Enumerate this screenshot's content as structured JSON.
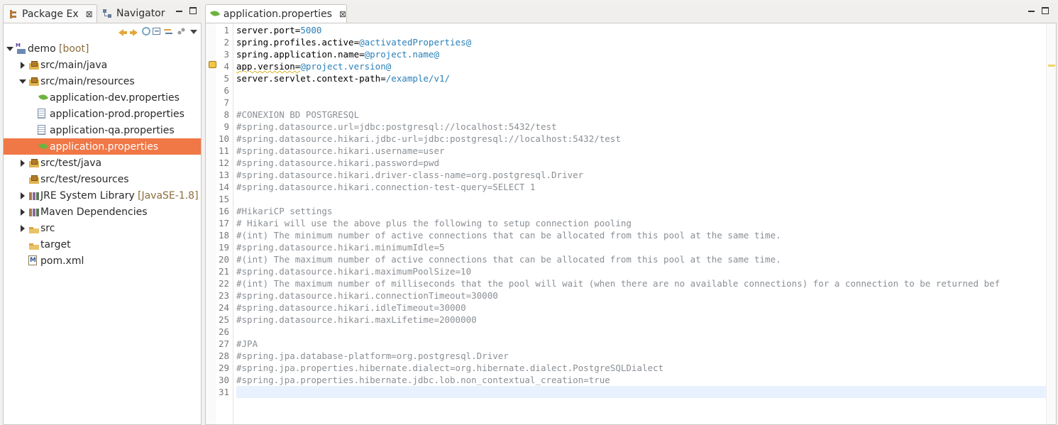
{
  "left_view": {
    "tabs": [
      {
        "label": "Package Ex",
        "close": "⊠"
      },
      {
        "label": "Navigator"
      }
    ],
    "tree": [
      {
        "label": "demo",
        "decoration": "[boot]",
        "icon": "project-icon",
        "indent": 0,
        "twisty": "open"
      },
      {
        "label": "src/main/java",
        "icon": "package-folder-icon",
        "indent": 1,
        "twisty": "closed"
      },
      {
        "label": "src/main/resources",
        "icon": "package-folder-icon",
        "indent": 1,
        "twisty": "open"
      },
      {
        "label": "application-dev.properties",
        "icon": "spring-leaf-icon",
        "indent": 2,
        "twisty": "none"
      },
      {
        "label": "application-prod.properties",
        "icon": "text-file-icon",
        "indent": 2,
        "twisty": "none"
      },
      {
        "label": "application-qa.properties",
        "icon": "text-file-icon",
        "indent": 2,
        "twisty": "none"
      },
      {
        "label": "application.properties",
        "icon": "spring-leaf-icon",
        "indent": 2,
        "twisty": "none",
        "selected": true
      },
      {
        "label": "src/test/java",
        "icon": "package-folder-icon",
        "indent": 1,
        "twisty": "closed"
      },
      {
        "label": "src/test/resources",
        "icon": "package-folder-icon",
        "indent": 1,
        "twisty": "none"
      },
      {
        "label": "JRE System Library",
        "decoration": "[JavaSE-1.8]",
        "icon": "library-icon",
        "indent": 1,
        "twisty": "closed"
      },
      {
        "label": "Maven Dependencies",
        "icon": "library-icon",
        "indent": 1,
        "twisty": "closed"
      },
      {
        "label": "src",
        "icon": "folder-icon",
        "indent": 1,
        "twisty": "closed"
      },
      {
        "label": "target",
        "icon": "folder-icon",
        "indent": 1,
        "twisty": "none"
      },
      {
        "label": "pom.xml",
        "icon": "maven-xml-icon",
        "indent": 1,
        "twisty": "none"
      }
    ],
    "selection_color": "#f07746"
  },
  "editor": {
    "tab": {
      "label": "application.properties",
      "close": "⊠"
    },
    "lines": [
      [
        {
          "t": "server.port=",
          "s": "k"
        },
        {
          "t": "5000",
          "s": "v"
        }
      ],
      [
        {
          "t": "spring.profiles.active=",
          "s": "k"
        },
        {
          "t": "@activatedProperties@",
          "s": "v"
        }
      ],
      [
        {
          "t": "spring.application.name=",
          "s": "k"
        },
        {
          "t": "@project.name@",
          "s": "v"
        }
      ],
      [
        {
          "t": "app.version=",
          "s": "k",
          "warn": true
        },
        {
          "t": "@project.version@",
          "s": "v"
        }
      ],
      [
        {
          "t": "server.servlet.context-path=",
          "s": "k"
        },
        {
          "t": "/example/v1/",
          "s": "v"
        }
      ],
      [],
      [],
      [
        {
          "t": "#CONEXION BD POSTGRESQL",
          "s": "c"
        }
      ],
      [
        {
          "t": "#spring.datasource.url=jdbc:postgresql://localhost:5432/test",
          "s": "c"
        }
      ],
      [
        {
          "t": "#spring.datasource.hikari.jdbc-url=jdbc:postgresql://localhost:5432/test",
          "s": "c"
        }
      ],
      [
        {
          "t": "#spring.datasource.hikari.username=user",
          "s": "c"
        }
      ],
      [
        {
          "t": "#spring.datasource.hikari.password=pwd",
          "s": "c"
        }
      ],
      [
        {
          "t": "#spring.datasource.hikari.driver-class-name=org.postgresql.Driver",
          "s": "c"
        }
      ],
      [
        {
          "t": "#spring.datasource.hikari.connection-test-query=SELECT 1",
          "s": "c"
        }
      ],
      [],
      [
        {
          "t": "#HikariCP settings",
          "s": "c"
        }
      ],
      [
        {
          "t": "# Hikari will use the above plus the following to setup connection pooling",
          "s": "c"
        }
      ],
      [
        {
          "t": "#(int) The minimum number of active connections that can be allocated from this pool at the same time.",
          "s": "c"
        }
      ],
      [
        {
          "t": "#spring.datasource.hikari.minimumIdle=5",
          "s": "c"
        }
      ],
      [
        {
          "t": "#(int) The maximum number of active connections that can be allocated from this pool at the same time.",
          "s": "c"
        }
      ],
      [
        {
          "t": "#spring.datasource.hikari.maximumPoolSize=10",
          "s": "c"
        }
      ],
      [
        {
          "t": "#(int) The maximum number of milliseconds that the pool will wait (when there are no available connections) for a connection to be returned bef",
          "s": "c"
        }
      ],
      [
        {
          "t": "#spring.datasource.hikari.connectionTimeout=30000",
          "s": "c"
        }
      ],
      [
        {
          "t": "#spring.datasource.hikari.idleTimeout=30000",
          "s": "c"
        }
      ],
      [
        {
          "t": "#spring.datasource.hikari.maxLifetime=2000000",
          "s": "c"
        }
      ],
      [],
      [
        {
          "t": "#JPA",
          "s": "c"
        }
      ],
      [
        {
          "t": "#spring.jpa.database-platform=org.postgresql.Driver",
          "s": "c"
        }
      ],
      [
        {
          "t": "#spring.jpa.properties.hibernate.dialect=org.hibernate.dialect.PostgreSQLDialect",
          "s": "c"
        }
      ],
      [
        {
          "t": "#spring.jpa.properties.hibernate.jdbc.lob.non_contextual_creation=true",
          "s": "c"
        }
      ],
      []
    ],
    "current_line": 31,
    "colors": {
      "key": "#000000",
      "value": "#2a80b9",
      "comment": "#8a8f94",
      "current_line_bg": "#e8f2fe"
    }
  }
}
